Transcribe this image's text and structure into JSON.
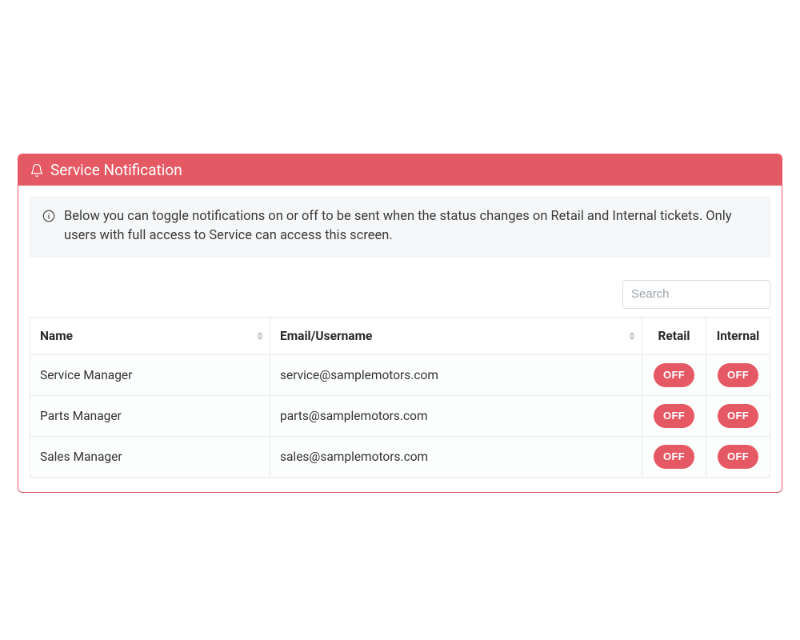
{
  "panel": {
    "title": "Service Notification"
  },
  "info": {
    "text": "Below you can toggle notifications on or off to be sent when the status changes on Retail and Internal tickets. Only users with full access to Service can access this screen."
  },
  "search": {
    "placeholder": "Search"
  },
  "table": {
    "headers": {
      "name": "Name",
      "email": "Email/Username",
      "retail": "Retail",
      "internal": "Internal"
    },
    "rows": [
      {
        "name": "Service Manager",
        "email": "service@samplemotors.com",
        "retail": "OFF",
        "internal": "OFF"
      },
      {
        "name": "Parts Manager",
        "email": "parts@samplemotors.com",
        "retail": "OFF",
        "internal": "OFF"
      },
      {
        "name": "Sales Manager",
        "email": "sales@samplemotors.com",
        "retail": "OFF",
        "internal": "OFF"
      }
    ]
  }
}
